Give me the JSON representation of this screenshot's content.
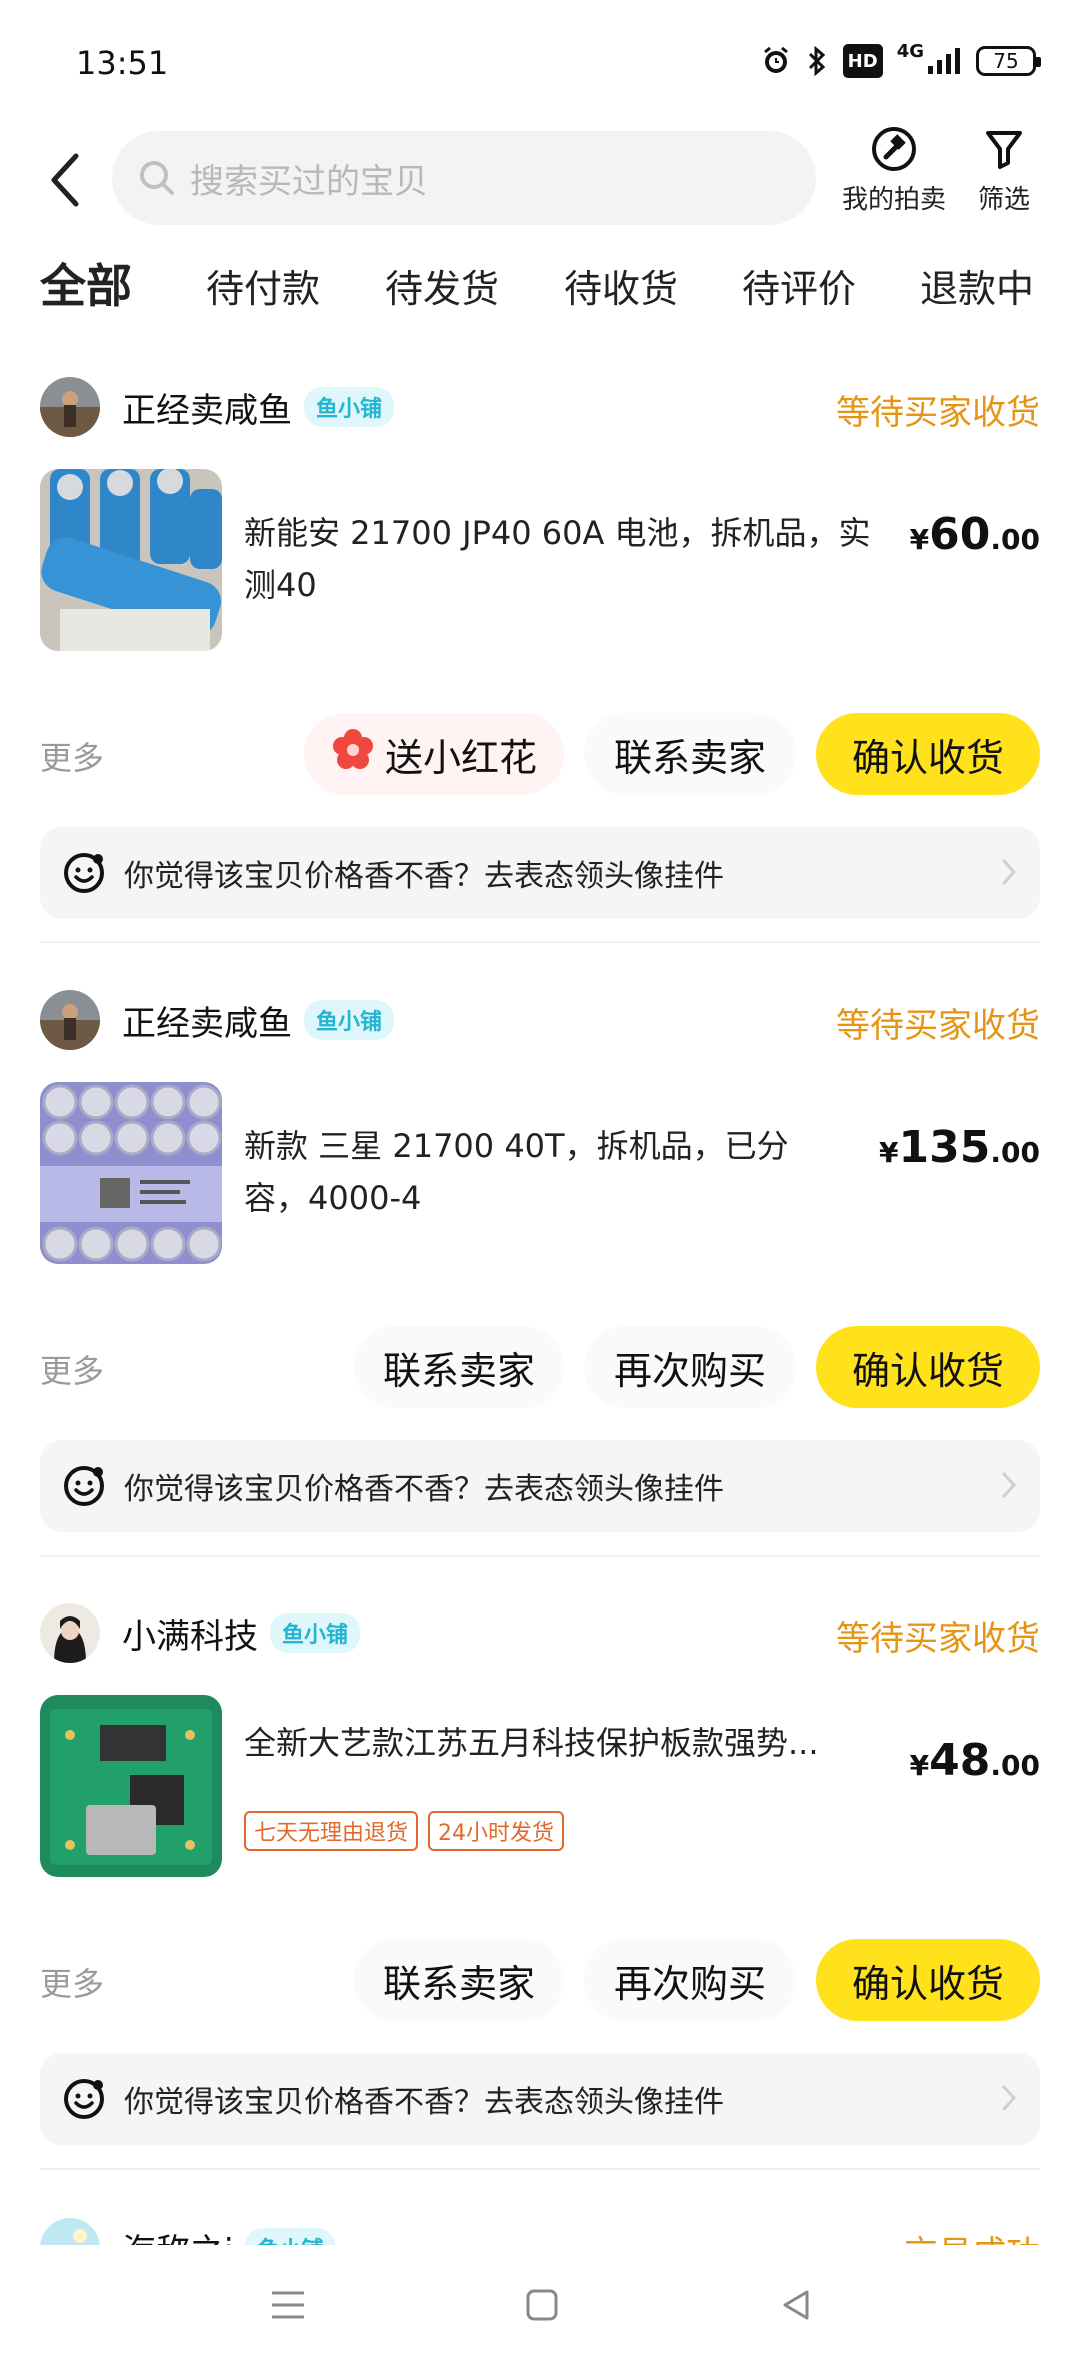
{
  "status_bar": {
    "time": "13:51",
    "battery": "75",
    "network": "4G",
    "hd_badge": "HD"
  },
  "header": {
    "search_placeholder": "搜索买过的宝贝",
    "auction_label": "我的拍卖",
    "filter_label": "筛选"
  },
  "tabs": [
    {
      "label": "全部",
      "active": true
    },
    {
      "label": "待付款"
    },
    {
      "label": "待发货"
    },
    {
      "label": "待收货"
    },
    {
      "label": "待评价"
    },
    {
      "label": "退款中"
    }
  ],
  "orders": [
    {
      "seller": "正经卖咸鱼",
      "shop_badge": "鱼小铺",
      "status": "等待买家收货",
      "title": "新能安 21700 JP40 60A 电池，拆机品，实测40",
      "price_symbol": "¥",
      "price_int": "60",
      "price_dec": ".00",
      "more": "更多",
      "buttons": [
        "送小红花",
        "联系卖家",
        "确认收货"
      ],
      "promo": "你觉得该宝贝价格香不香？去表态领头像挂件"
    },
    {
      "seller": "正经卖咸鱼",
      "shop_badge": "鱼小铺",
      "status": "等待买家收货",
      "title": "新款 三星 21700 40T，拆机品，已分容，4000-4",
      "price_symbol": "¥",
      "price_int": "135",
      "price_dec": ".00",
      "more": "更多",
      "buttons": [
        "联系卖家",
        "再次购买",
        "确认收货"
      ],
      "promo": "你觉得该宝贝价格香不香？去表态领头像挂件"
    },
    {
      "seller": "小满科技",
      "shop_badge": "鱼小铺",
      "status": "等待买家收货",
      "title": "全新大艺款江苏五月科技保护板款强势...",
      "tags": [
        "七天无理由退货",
        "24小时发货"
      ],
      "price_symbol": "¥",
      "price_int": "48",
      "price_dec": ".00",
      "more": "更多",
      "buttons": [
        "联系卖家",
        "再次购买",
        "确认收货"
      ],
      "promo": "你觉得该宝贝价格香不香？去表态领头像挂件"
    },
    {
      "seller": "海称之i",
      "shop_badge": "鱼小铺",
      "status": "交易成功"
    }
  ],
  "colors": {
    "accent_yellow": "#ffe21c",
    "status_orange": "#e59413",
    "badge_cyan": "#23b6d3",
    "tag_red": "#e2692c"
  }
}
